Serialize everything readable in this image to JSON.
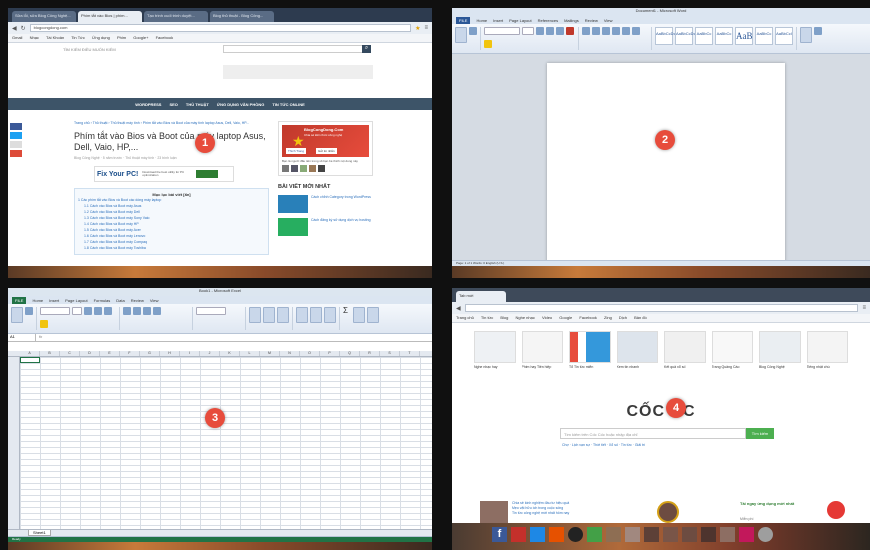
{
  "markers": [
    "1",
    "2",
    "3",
    "4"
  ],
  "blog": {
    "tabs": [
      "Sửa lỗi, sửa Blog Công Nghệ...",
      "Phím tắt vào Bios | phím...",
      "Tạo trình cuối trình duyệt...",
      "Blog thủ thuật - Blog Công..."
    ],
    "url": "blogcongdong.com",
    "bookmarks": [
      "Gmail",
      "Nhạc",
      "Tài Khoản",
      "Tin Tức",
      "Ứng dụng",
      "Phim",
      "Google+",
      "Facebook"
    ],
    "search_text": "TÌM KIẾM ĐIỀU MUỐN KIẾM",
    "nav_items": [
      "WORDPRESS",
      "SEO",
      "THỦ THUẬT",
      "ỨNG DỤNG VĂN PHÒNG",
      "TIN TỨC ONLINE"
    ],
    "breadcrumb": "Trang chủ › Thủ thuật › Thủ thuật máy tính › Phím tắt vào Bios và Boot của máy tính laptop Asus, Dell, Vaio, HP...",
    "title": "Phím tắt vào Bios và Boot của máy laptop Asus, Dell, Vaio, HP,...",
    "meta": "Blog Công Nghệ  ·  5 năm trước  ·  Thủ thuật máy tính  ·  23 bình luận",
    "ad_title": "Fix Your PC!",
    "ad_text": "Download the best utility for PC optimization",
    "toc_title": "Mục lục bài viết [ẩn]",
    "toc_items": [
      "1 Các phím tắt vào Bios và Boot các dòng máy laptop",
      "1.1 Cách vào Bios và Boot máy Asus",
      "1.2 Cách vào Bios và Boot máy Dell",
      "1.3 Cách vào Bios và Boot máy Sony Vaio",
      "1.4 Cách vào Bios và Boot máy HP",
      "1.5 Cách vào Bios và Boot máy Acer",
      "1.6 Cách vào Bios và Boot máy Lenovo",
      "1.7 Cách vào Bios và Boot máy Compaq",
      "1.8 Cách vào Bios và Boot máy Toshiba"
    ],
    "side_brand": "BlogCongDong.Com",
    "side_sub": "Chia sẻ kiến thức công nghệ",
    "side_like": "Thích Trang",
    "side_follow": "Gửi tin nhắn",
    "side_desc": "Bạn là người đầu tiên trong số bạn bè thích nội dung này",
    "recent_title": "BÀI VIẾT MỚI NHẤT",
    "recent_items": [
      "Cách chỉnh Category trong WordPress",
      "Cách đăng ký sử dụng dịch vụ hosting"
    ]
  },
  "word": {
    "title": "Document1 - Microsoft Word",
    "tabs": [
      "FILE",
      "Home",
      "Insert",
      "Page Layout",
      "References",
      "Mailings",
      "Review",
      "View"
    ],
    "styles": [
      "AaBbCcDc",
      "AaBbCcDc",
      "AaBbCc",
      "AaBbCc",
      "AaB",
      "AaBbCc",
      "AaBbCcI"
    ],
    "status": "Page: 1 of 1   Words: 0   English (U.S.)"
  },
  "excel": {
    "title": "Book1 - Microsoft Excel",
    "tabs": [
      "FILE",
      "Home",
      "Insert",
      "Page Layout",
      "Formulas",
      "Data",
      "Review",
      "View"
    ],
    "name_box": "A1",
    "columns": [
      "A",
      "B",
      "C",
      "D",
      "E",
      "F",
      "G",
      "H",
      "I",
      "J",
      "K",
      "L",
      "M",
      "N",
      "O",
      "P",
      "Q",
      "R",
      "S",
      "T"
    ],
    "sheet_tab": "Sheet1",
    "status": "Ready"
  },
  "coccoc": {
    "tab": "Tab mới",
    "url": "",
    "bookmarks": [
      "Trang chủ",
      "Tin tức",
      "Blog",
      "Nghe nhạc",
      "Video",
      "Google",
      "Facebook",
      "Zing",
      "Dịch",
      "Bản đồ"
    ],
    "logo_left": "CỐC",
    "logo_right": "C",
    "search_placeholder": "Tìm kiếm trên Cốc Cốc hoặc nhập địa chỉ",
    "search_button": "Tìm kiếm",
    "links": "Chợ · Lịch vạn sự · Thời tiết · Xổ số · Tin tức · Giải trí",
    "thumb_labels": [
      "Nghe nhạc hay",
      "Phim hay Tiên hiệp",
      "Tổ Tin tức miễn",
      "Xem tin nhanh",
      "Kết quả xổ số",
      "Trang Quảng Cáo",
      "Blog Công Nghệ",
      "Tiếng nhật chú"
    ],
    "news": [
      "Chia sẻ kinh nghiệm đầu tư hiệu quả",
      "Mẹo vặt hữu ích trong cuộc sống",
      "Tin tức công nghệ mới nhất hôm nay"
    ],
    "promo_title": "Tải ngay ứng dụng mới nhất",
    "promo_sub": "Miễn phí"
  }
}
